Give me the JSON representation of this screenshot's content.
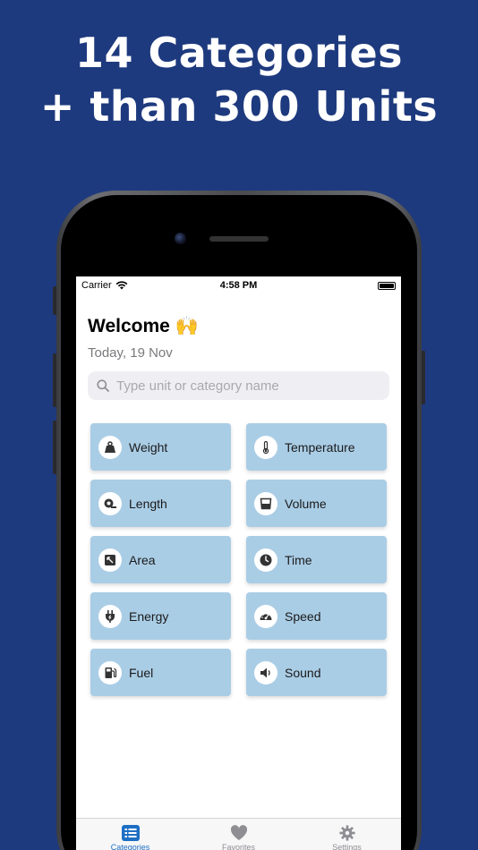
{
  "headline": {
    "line1": "14 Categories",
    "line2": "+ than 300 Units"
  },
  "status_bar": {
    "carrier": "Carrier",
    "time": "4:58 PM"
  },
  "welcome": {
    "title": "Welcome 🙌",
    "date": "Today, 19 Nov"
  },
  "search": {
    "placeholder": "Type unit or category name"
  },
  "categories": [
    {
      "label": "Weight",
      "icon": "weight-icon"
    },
    {
      "label": "Temperature",
      "icon": "thermometer-icon"
    },
    {
      "label": "Length",
      "icon": "tape-measure-icon"
    },
    {
      "label": "Volume",
      "icon": "cup-icon"
    },
    {
      "label": "Area",
      "icon": "area-icon"
    },
    {
      "label": "Time",
      "icon": "clock-icon"
    },
    {
      "label": "Energy",
      "icon": "plug-icon"
    },
    {
      "label": "Speed",
      "icon": "speedometer-icon"
    },
    {
      "label": "Fuel",
      "icon": "gas-pump-icon"
    },
    {
      "label": "Sound",
      "icon": "speaker-icon"
    }
  ],
  "tabs": [
    {
      "label": "Categories",
      "icon": "list-icon",
      "active": true
    },
    {
      "label": "Favorites",
      "icon": "heart-icon",
      "active": false
    },
    {
      "label": "Settings",
      "icon": "gear-icon",
      "active": false
    }
  ],
  "colors": {
    "background": "#1e3a7e",
    "card": "#aacde6",
    "accent": "#1d6fc4"
  }
}
